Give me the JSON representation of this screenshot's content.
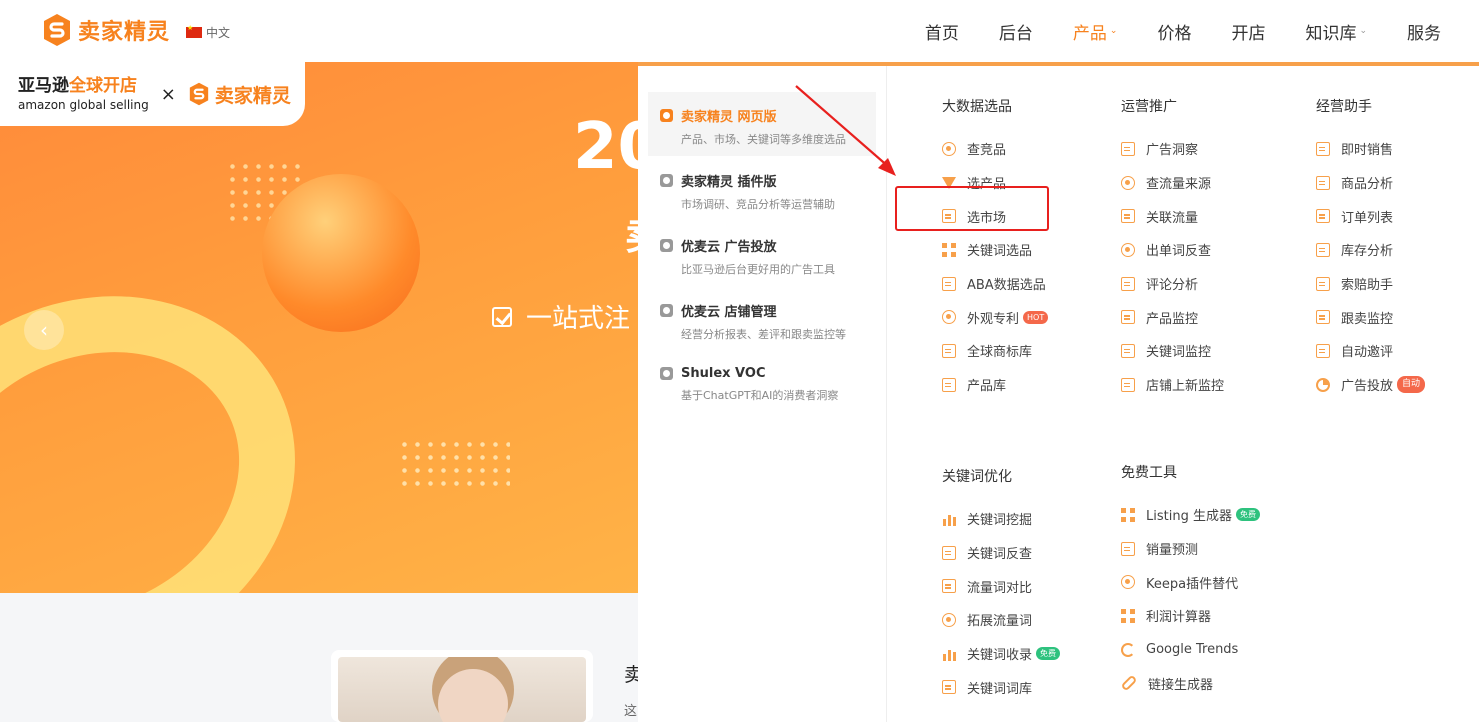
{
  "header": {
    "logo_text": "卖家精灵",
    "lang": "中文",
    "nav": [
      {
        "label": "首页",
        "caret": false
      },
      {
        "label": "后台",
        "caret": false
      },
      {
        "label": "产品",
        "caret": true,
        "active": true
      },
      {
        "label": "价格",
        "caret": false
      },
      {
        "label": "开店",
        "caret": false
      },
      {
        "label": "知识库",
        "caret": true
      },
      {
        "label": "服务",
        "caret": false
      }
    ]
  },
  "partner": {
    "amazon_cn_prefix": "亚马逊",
    "amazon_cn_suffix": "全球开店",
    "amazon_en": "amazon global selling",
    "times": "×",
    "logo_text": "卖家精灵"
  },
  "hero": {
    "year": "20",
    "sub1": "卖",
    "tagline": "一站式注",
    "prev": "‹"
  },
  "below": {
    "side_title": "卖",
    "side_text": "这"
  },
  "products": [
    {
      "title": "卖家精灵 网页版",
      "desc": "产品、市场、关键词等多维度选品",
      "selected": true
    },
    {
      "title": "卖家精灵 插件版",
      "desc": "市场调研、竞品分析等运营辅助"
    },
    {
      "title": "优麦云 广告投放",
      "desc": "比亚马逊后台更好用的广告工具"
    },
    {
      "title": "优麦云 店铺管理",
      "desc": "经营分析报表、差评和跟卖监控等"
    },
    {
      "title": "Shulex VOC",
      "desc": "基于ChatGPT和AI的消费者洞察"
    }
  ],
  "columns": {
    "big_data": {
      "title": "大数据选品",
      "items": [
        {
          "label": "查竞品",
          "icon": "search-icon"
        },
        {
          "label": "选产品",
          "icon": "funnel-icon"
        },
        {
          "label": "选市场",
          "icon": "market-icon"
        },
        {
          "label": "关键词选品",
          "icon": "grid-icon"
        },
        {
          "label": "ABA数据选品",
          "icon": "chart-icon"
        },
        {
          "label": "外观专利",
          "icon": "patent-icon",
          "badge": "HOT"
        },
        {
          "label": "全球商标库",
          "icon": "trademark-icon"
        },
        {
          "label": "产品库",
          "icon": "box-icon"
        }
      ]
    },
    "ops": {
      "title": "运营推广",
      "items": [
        {
          "label": "广告洞察",
          "icon": "ad-icon"
        },
        {
          "label": "查流量来源",
          "icon": "traffic-icon"
        },
        {
          "label": "关联流量",
          "icon": "link-traffic-icon"
        },
        {
          "label": "出单词反查",
          "icon": "keyword-reverse-icon"
        },
        {
          "label": "评论分析",
          "icon": "comment-icon"
        },
        {
          "label": "产品监控",
          "icon": "monitor-icon"
        },
        {
          "label": "关键词监控",
          "icon": "keyword-monitor-icon"
        },
        {
          "label": "店铺上新监控",
          "icon": "store-icon"
        }
      ]
    },
    "assistant": {
      "title": "经营助手",
      "items": [
        {
          "label": "即时销售",
          "icon": "sales-icon"
        },
        {
          "label": "商品分析",
          "icon": "analysis-icon"
        },
        {
          "label": "订单列表",
          "icon": "order-icon"
        },
        {
          "label": "库存分析",
          "icon": "inventory-icon"
        },
        {
          "label": "索赔助手",
          "icon": "claim-icon"
        },
        {
          "label": "跟卖监控",
          "icon": "follow-sell-icon"
        },
        {
          "label": "自动邀评",
          "icon": "review-invite-icon"
        },
        {
          "label": "广告投放",
          "icon": "pie-icon",
          "badge": "自动"
        }
      ]
    },
    "keyword_opt": {
      "title": "关键词优化",
      "items": [
        {
          "label": "关键词挖掘",
          "icon": "database-icon"
        },
        {
          "label": "关键词反查",
          "icon": "reverse-search-icon"
        },
        {
          "label": "流量词对比",
          "icon": "compare-icon"
        },
        {
          "label": "拓展流量词",
          "icon": "expand-icon"
        },
        {
          "label": "关键词收录",
          "icon": "bar-chart-icon",
          "badge": "免费"
        },
        {
          "label": "关键词词库",
          "icon": "library-icon"
        }
      ]
    },
    "free_tools": {
      "title": "免费工具",
      "items": [
        {
          "label": "Listing 生成器",
          "icon": "listing-icon",
          "badge": "免费"
        },
        {
          "label": "销量预测",
          "icon": "forecast-icon"
        },
        {
          "label": "Keepa插件替代",
          "icon": "keepa-icon"
        },
        {
          "label": "利润计算器",
          "icon": "calculator-icon"
        },
        {
          "label": "Google Trends",
          "icon": "google-icon"
        },
        {
          "label": "链接生成器",
          "icon": "link-icon"
        }
      ]
    }
  },
  "colors": {
    "brand": "#f7821e",
    "highlight": "#e8201e",
    "hot_badge": "#f4684a",
    "free_badge": "#2ec27e"
  }
}
